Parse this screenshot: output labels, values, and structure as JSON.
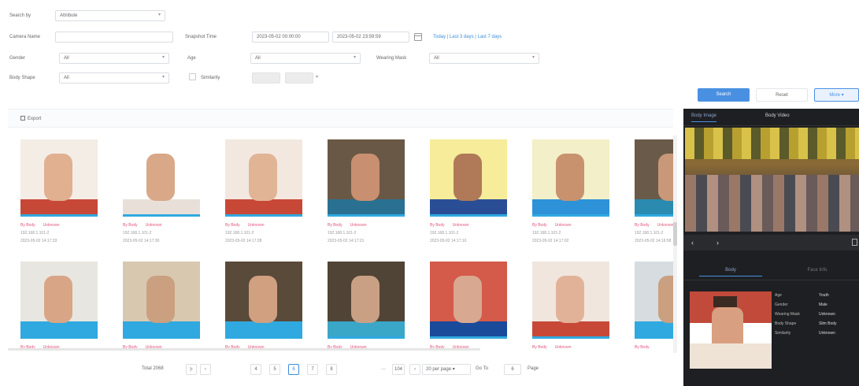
{
  "filters": {
    "search_by_label": "Search by",
    "search_by_value": "Attribute",
    "camera_name_label": "Camera Name",
    "snapshot_time_label": "Snapshot Time",
    "start_time": "2023-05-02 00:00:00",
    "end_time": "2023-05-02 23:59:59",
    "quick_links": "Today | Last 3 days | Last 7 days",
    "gender_label": "Gender",
    "gender_value": "All",
    "age_label": "Age",
    "age_value": "All",
    "mask_label": "Wearing Mask",
    "mask_value": "All",
    "body_shape_label": "Body Shape",
    "body_shape_value": "All",
    "similarity_label": "Similarity",
    "similarity_min": "",
    "similarity_max": ""
  },
  "actions": {
    "search": "Search",
    "reset": "Reset",
    "more": "More"
  },
  "toolbar": {
    "export_label": "Export"
  },
  "cards": [
    {
      "l1a": "By Body",
      "l1b": "Unknown",
      "l2": "192.168.1.101-2",
      "l3": "2023-05-02 14:17:33"
    },
    {
      "l1a": "By Body",
      "l1b": "Unknown",
      "l2": "192.168.1.101-2",
      "l3": "2023-05-02 14:17:30"
    },
    {
      "l1a": "By Body",
      "l1b": "Unknown",
      "l2": "192.168.1.101-2",
      "l3": "2023-05-02 14:17:28"
    },
    {
      "l1a": "By Body",
      "l1b": "Unknown",
      "l2": "192.168.1.101-2",
      "l3": "2023-05-02 14:17:21"
    },
    {
      "l1a": "By Body",
      "l1b": "Unknown",
      "l2": "192.168.1.101-2",
      "l3": "2023-05-02 14:17:10"
    },
    {
      "l1a": "By Body",
      "l1b": "Unknown",
      "l2": "192.168.1.101-2",
      "l3": "2023-05-02 14:17:02"
    },
    {
      "l1a": "By Body",
      "l1b": "Unknown",
      "l2": "192.168.1.101-2",
      "l3": "2023-05-02 14:16:58"
    },
    {
      "l1a": "By Body",
      "l1b": "Unknown",
      "l2": "",
      "l3": ""
    },
    {
      "l1a": "By Body",
      "l1b": "Unknown",
      "l2": "",
      "l3": ""
    },
    {
      "l1a": "By Body",
      "l1b": "Unknown",
      "l2": "",
      "l3": ""
    },
    {
      "l1a": "By Body",
      "l1b": "Unknown",
      "l2": "",
      "l3": ""
    },
    {
      "l1a": "By Body",
      "l1b": "Unknown",
      "l2": "",
      "l3": ""
    },
    {
      "l1a": "By Body",
      "l1b": "Unknown",
      "l2": "",
      "l3": ""
    },
    {
      "l1a": "By Body",
      "l1b": "",
      "l2": "",
      "l3": ""
    }
  ],
  "pagination": {
    "total": "Total 2068",
    "pages": [
      "4",
      "5",
      "6",
      "7",
      "8"
    ],
    "active_page": "6",
    "last_page": "104",
    "per_page": "20 per page",
    "goto_label": "Go To",
    "goto_value": "6",
    "page_suffix": "Page"
  },
  "panel": {
    "tab_body_image": "Body Image",
    "tab_body_video": "Body Video",
    "sub_tab_body": "Body",
    "sub_tab_face": "Face Info",
    "attr_labels": [
      "Age",
      "Gender",
      "Wearing Mask",
      "Body Shape",
      "Similarity"
    ],
    "attr_values": [
      "Youth",
      "Male",
      "Unknown",
      "Slim Body",
      "Unknown"
    ]
  },
  "colors": {
    "accent": "#3b8ed8",
    "pink": "#e0567a",
    "panel_bg": "#1e1f22"
  }
}
